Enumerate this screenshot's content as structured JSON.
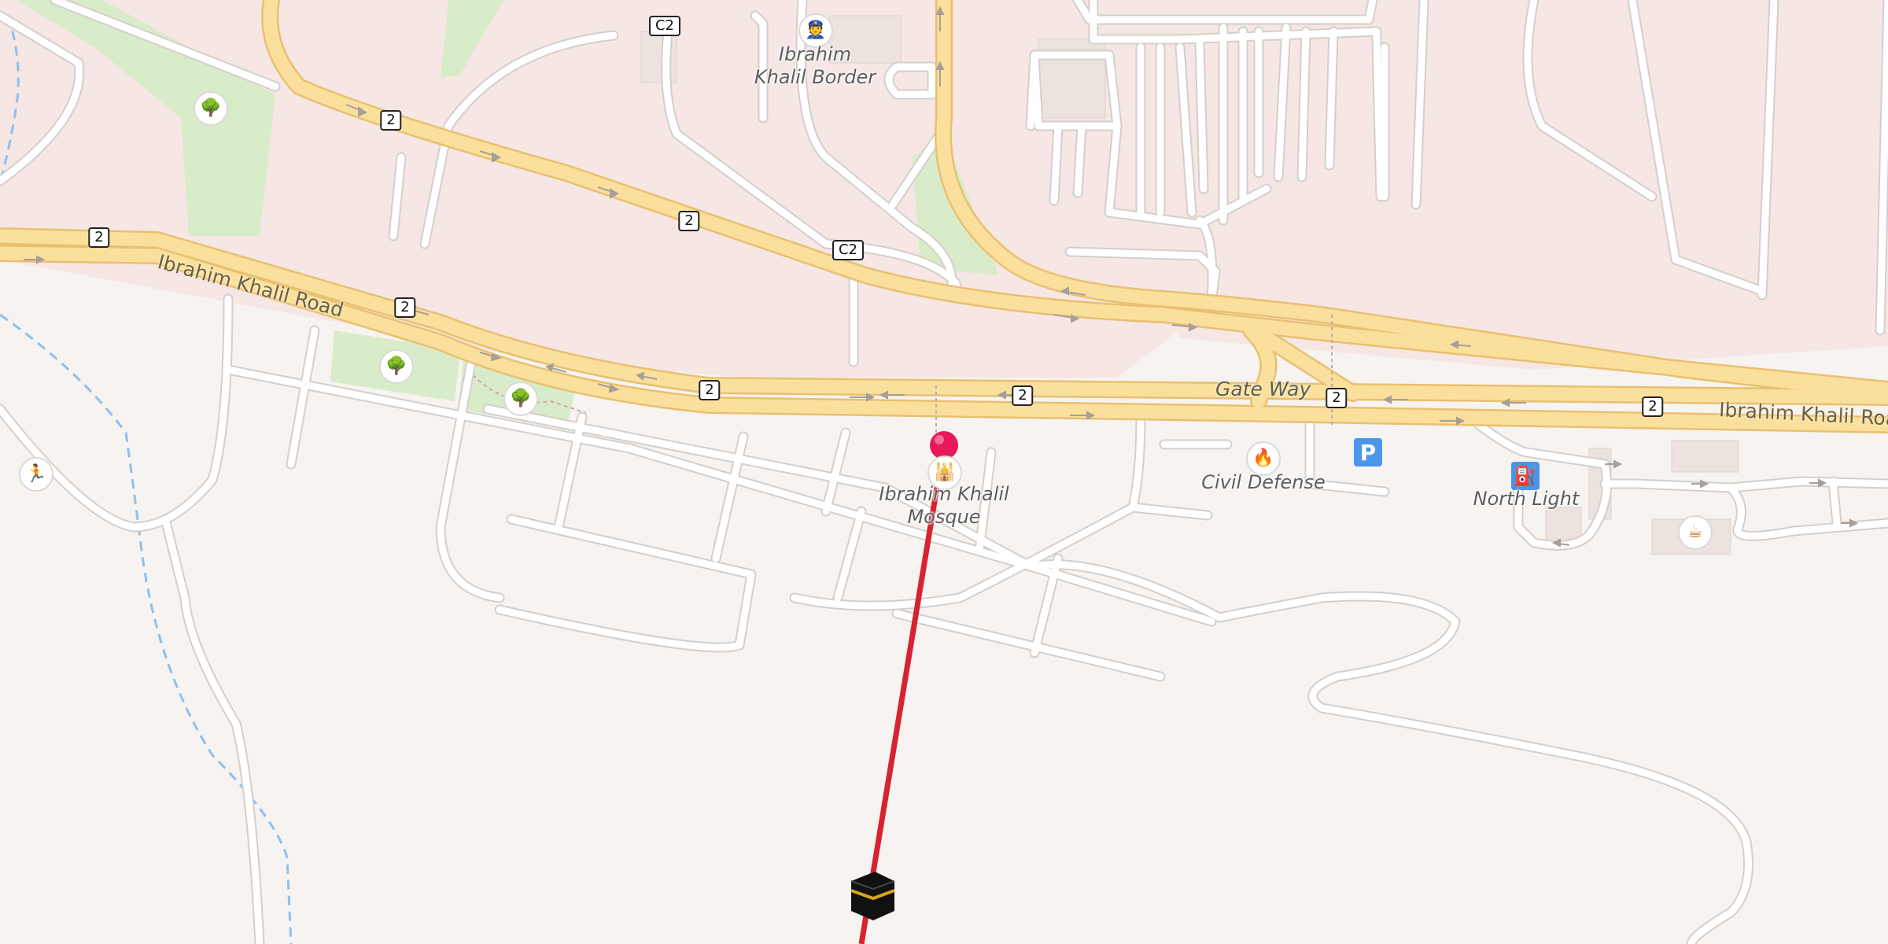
{
  "map": {
    "road_names": {
      "ibrahim_khalil_road_west": "Ibrahim Khalil Road",
      "ibrahim_khalil_road_east": "Ibrahim Khalil Roa",
      "gate_way": "Gate Way"
    },
    "shields": {
      "route_2": "2",
      "route_c2": "C2"
    },
    "places": {
      "border": "Ibrahim\nKhalil Border",
      "mosque": "Ibrahim Khalil\nMosque",
      "civil_defense": "Civil Defense",
      "north_light": "North Light"
    },
    "icons": {
      "park": "tree-icon",
      "border": "customs-officer-icon",
      "mosque": "mosque-icon",
      "civil_defense": "fire-station-icon",
      "parking": "parking-icon",
      "parking_glyph": "P",
      "fuel": "fuel-station-icon",
      "cafe": "coffee-cup-icon",
      "sport": "runner-icon",
      "kaaba": "kaaba-icon",
      "pin": "map-pin-icon"
    },
    "colors": {
      "background": "#f6f3f0",
      "urban_area": "#f6e6e4",
      "park": "#d9ecc9",
      "major_road": "#fbe09d",
      "major_road_casing": "#e8c070",
      "minor_road": "#ffffff",
      "minor_road_casing": "#d4cfcb",
      "stream": "#8ec0ef",
      "route_line": "#d7232f",
      "pin": "#e8195a",
      "parking": "#4b95e8"
    }
  }
}
